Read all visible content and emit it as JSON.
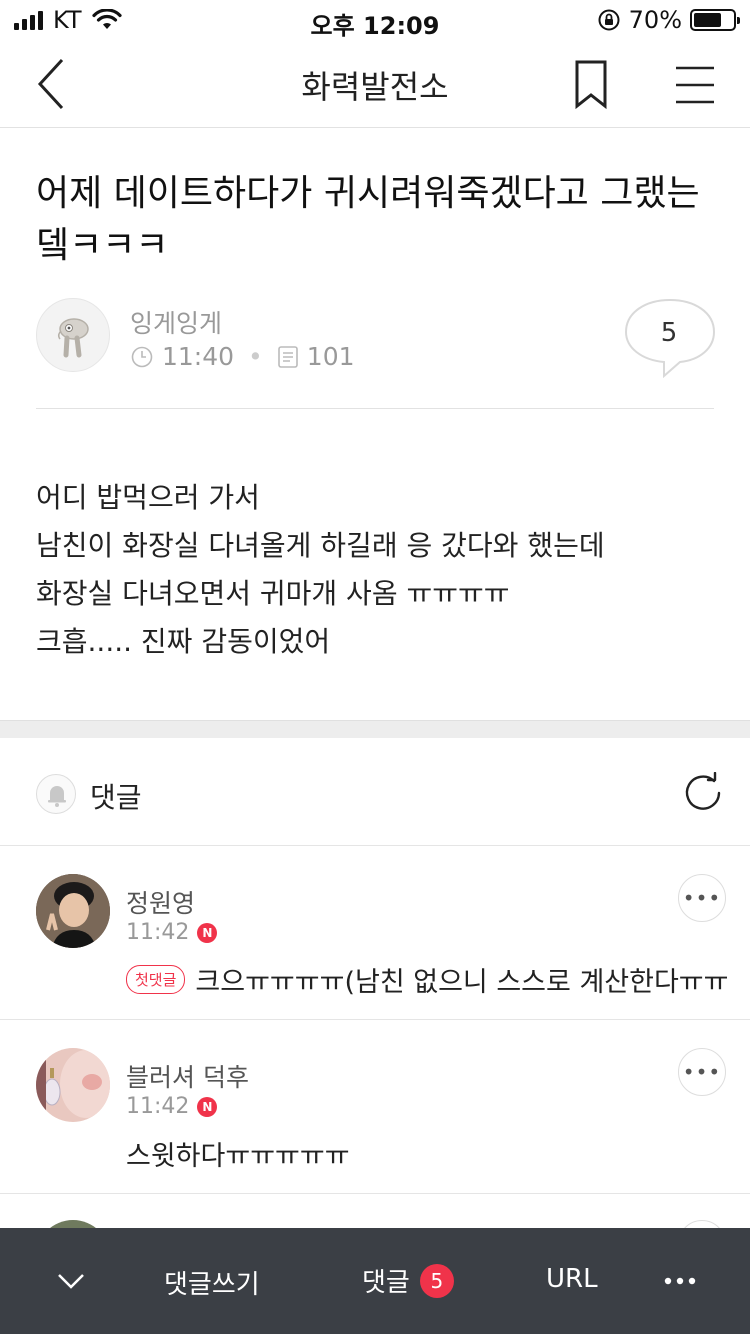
{
  "status_bar": {
    "carrier": "KT",
    "time": "오후 12:09",
    "battery": "70%",
    "battery_level": 0.7
  },
  "nav": {
    "title": "화력발전소",
    "back_icon": "chevron-left-icon",
    "bookmark_icon": "bookmark-icon",
    "menu_icon": "hamburger-menu-icon"
  },
  "post": {
    "title": "어제 데이트하다가 귀시려워죽겠다고 그랬는뎈ㅋㅋㅋ",
    "author": "잉게잉게",
    "time": "11:40",
    "views": "101",
    "comment_count": "5",
    "body": [
      "어디 밥먹으러 가서",
      "남친이 화장실 다녀올게 하길래 응 갔다와 했는데",
      "화장실 다녀오면서 귀마개 사옴 ㅠㅠㅠㅠ",
      "크흡..... 진짜 감동이었어"
    ]
  },
  "comments_section": {
    "title": "댓글",
    "items": [
      {
        "name": "정원영",
        "time": "11:42",
        "new_badge": "N",
        "first_label": "첫댓글",
        "text": "크으ㅠㅠㅠㅠ(남친 없으니 스스로 계산한다ㅠㅠ"
      },
      {
        "name": "블러셔 덕후",
        "time": "11:42",
        "new_badge": "N",
        "text": "스윗하다ㅠㅠㅠㅠㅠ"
      }
    ]
  },
  "bottom_bar": {
    "collapse_icon": "chevron-down-icon",
    "write_label": "댓글쓰기",
    "comments_label": "댓글",
    "comments_count": "5",
    "url_label": "URL",
    "more_icon": "more-dots-icon"
  },
  "colors": {
    "accent_red": "#f0334a",
    "toolbar_bg": "#3b3f45"
  }
}
